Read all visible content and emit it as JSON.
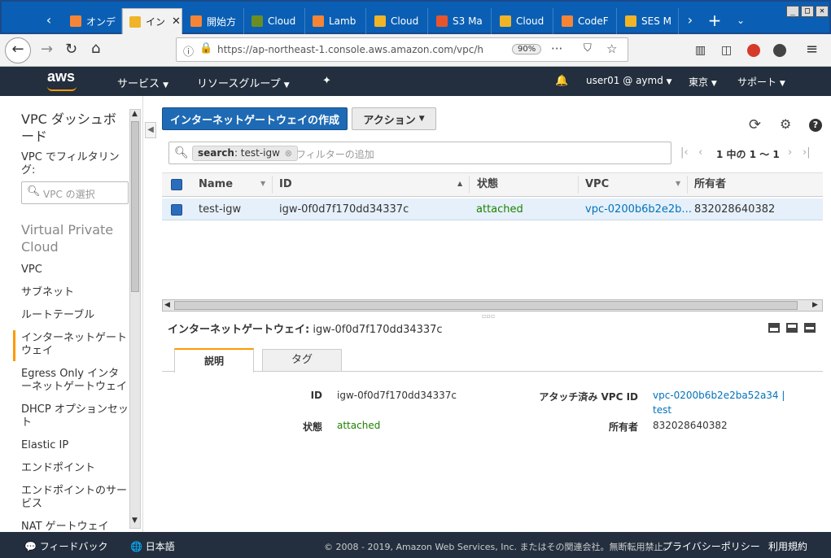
{
  "browser": {
    "tabs": [
      {
        "label": "オンデ",
        "color": "#f58536"
      },
      {
        "label": "イン",
        "color": "#f0b429"
      },
      {
        "label": "開始方",
        "color": "#f58536"
      },
      {
        "label": "Cloud",
        "color": "#6b8e23"
      },
      {
        "label": "Lamb",
        "color": "#f58536"
      },
      {
        "label": "Cloud",
        "color": "#f0b429"
      },
      {
        "label": "S3 Ma",
        "color": "#e8552d"
      },
      {
        "label": "Cloud",
        "color": "#f0b429"
      },
      {
        "label": "CodeF",
        "color": "#f58536"
      },
      {
        "label": "SES M",
        "color": "#f0b429"
      }
    ],
    "url": "https://ap-northeast-1.console.aws.amazon.com/vpc/h",
    "zoom": "90%"
  },
  "aws_header": {
    "logo": "aws",
    "services": "サービス",
    "resource_groups": "リソースグループ",
    "user": "user01 @ aymd",
    "region": "東京",
    "support": "サポート"
  },
  "sidebar": {
    "dashboard": "VPC ダッシュボード",
    "filter_label": "VPC でフィルタリング:",
    "filter_placeholder": "VPC の選択",
    "section": "Virtual Private Cloud",
    "items": [
      "VPC",
      "サブネット",
      "ルートテーブル",
      "インターネットゲートウェイ",
      "Egress Only インターネットゲートウェイ",
      "DHCP オプションセット",
      "Elastic IP",
      "エンドポイント",
      "エンドポイントのサービス",
      "NAT ゲートウェイ"
    ]
  },
  "toolbar": {
    "create_button": "インターネットゲートウェイの作成",
    "actions_button": "アクション"
  },
  "search": {
    "tag_key": "search",
    "tag_value": ": test-igw",
    "placeholder": "フィルターの追加",
    "pagination": "1 中の 1 〜 1"
  },
  "table": {
    "headers": [
      "Name",
      "ID",
      "状態",
      "VPC",
      "所有者"
    ],
    "rows": [
      {
        "name": "test-igw",
        "id": "igw-0f0d7f170dd34337c",
        "state": "attached",
        "vpc": "vpc-0200b6b2e2b...",
        "owner": "832028640382"
      }
    ]
  },
  "detail": {
    "title_label": "インターネットゲートウェイ:",
    "title_value": "igw-0f0d7f170dd34337c",
    "tabs": [
      "説明",
      "タグ"
    ],
    "fields": {
      "id_label": "ID",
      "id_value": "igw-0f0d7f170dd34337c",
      "state_label": "状態",
      "state_value": "attached",
      "vpc_label": "アタッチ済み VPC ID",
      "vpc_value": "vpc-0200b6b2e2ba52a34 |",
      "vpc_value2": "test",
      "owner_label": "所有者",
      "owner_value": "832028640382"
    }
  },
  "footer": {
    "feedback": "フィードバック",
    "language": "日本語",
    "copyright": "© 2008 - 2019, Amazon Web Services, Inc. またはその関連会社。無断転用禁止。",
    "privacy": "プライバシーポリシー",
    "terms": "利用規約"
  },
  "colors": {
    "aws_nav": "#232f3e",
    "primary": "#1f6ab4",
    "attached": "#1d8102",
    "link": "#0073bb"
  }
}
